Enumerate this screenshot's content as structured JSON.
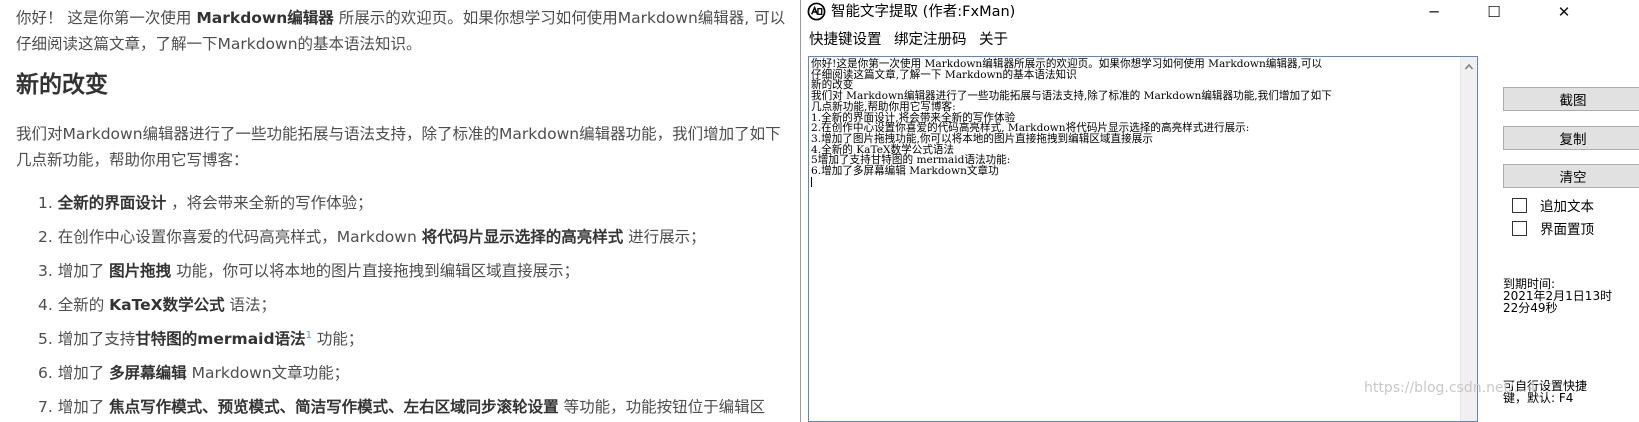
{
  "article": {
    "intro": {
      "a": "你好！ 这是你第一次使用 ",
      "b": "Markdown编辑器",
      "c": " 所展示的欢迎页。如果你想学习如何使用Markdown编辑器, 可以仔细阅读这篇文章，了解一下Markdown的基本语法知识。"
    },
    "heading": "新的改变",
    "para": "我们对Markdown编辑器进行了一些功能拓展与语法支持，除了标准的Markdown编辑器功能，我们增加了如下几点新功能，帮助你用它写博客：",
    "items": [
      {
        "num": "1. ",
        "pre": "",
        "bold": "全新的界面设计",
        "post": " ，将会带来全新的写作体验；",
        "sup": ""
      },
      {
        "num": "2. ",
        "pre": "在创作中心设置你喜爱的代码高亮样式，Markdown ",
        "bold": "将代码片显示选择的高亮样式",
        "post": " 进行展示；",
        "sup": ""
      },
      {
        "num": "3. ",
        "pre": "增加了 ",
        "bold": "图片拖拽",
        "post": " 功能，你可以将本地的图片直接拖拽到编辑区域直接展示；",
        "sup": ""
      },
      {
        "num": "4. ",
        "pre": "全新的 ",
        "bold": "KaTeX数学公式",
        "post": " 语法；",
        "sup": ""
      },
      {
        "num": "5. ",
        "pre": "增加了支持",
        "bold": "甘特图的mermaid语法",
        "post": " 功能；",
        "sup": "1"
      },
      {
        "num": "6. ",
        "pre": "增加了 ",
        "bold": "多屏幕编辑",
        "post": " Markdown文章功能；",
        "sup": ""
      },
      {
        "num": "7. ",
        "pre": "增加了 ",
        "bold": "焦点写作模式、预览模式、简洁写作模式、左右区域同步滚轮设置",
        "post": " 等功能，功能按钮位于编辑区",
        "sup": ""
      }
    ]
  },
  "window": {
    "title": "智能文字提取 (作者:FxMan)",
    "minimize": "─",
    "maximize": "☐",
    "close": "✕",
    "menu": [
      "快捷键设置",
      "绑定注册码",
      "关于"
    ],
    "ocr_text": "你好!这是你第一次使用 Markdown编辑器所展示的欢迎页。如果你想学习如何使用 Markdown编辑器,可以\n仔细阅读这篇文章,了解一下 Markdown的基本语法知识\n新的改变\n我们对 Markdown编辑器进行了一些功能拓展与语法支持,除了标准的 Markdown编辑器功能,我们增加了如下\n几点新功能,帮助你用它写博客:\n1.全新的界面设计,将会带来全新的写作体验\n2.在创作中心设置你喜爱的代码高亮样式, Markdown将代码片显示选择的高亮样式进行展示:\n3.增加了图片拖拽功能,你可以将本地的图片直接拖拽到编辑区域直接展示\n4.全新的 KaTeX数学公式语法\n5增加了支持甘特图的 mermaid语法功能:\n6.增加了多屏幕编辑 Markdown文章功",
    "buttons": {
      "screenshot": "截图",
      "copy": "复制",
      "clear": "清空"
    },
    "checkboxes": {
      "append": "追加文本",
      "topmost": "界面置顶"
    },
    "expire_label": "到期时间:",
    "expire_line1": "2021年2月1日13时",
    "expire_line2": "22分49秒",
    "hint_line1": "可自行设置快捷",
    "hint_line2": "键，默认: F4"
  },
  "watermark": "https://blog.csdn.net/...4"
}
